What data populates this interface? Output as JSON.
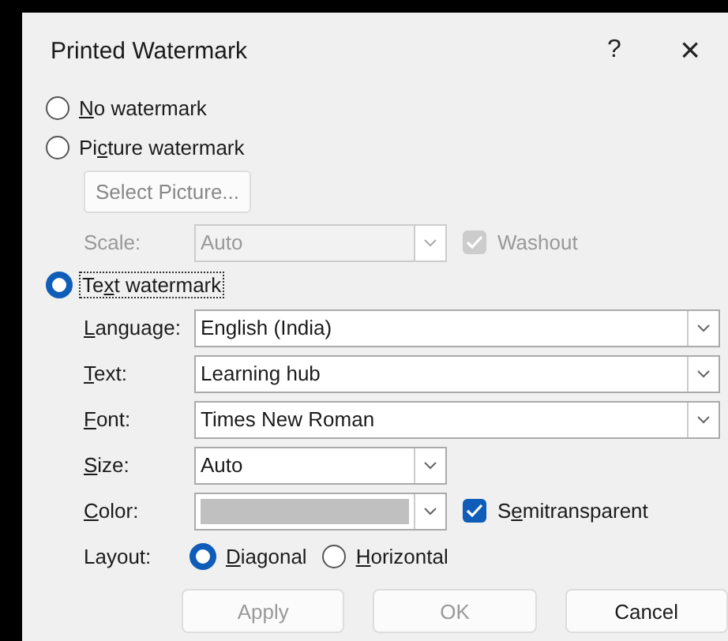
{
  "window": {
    "title": "Printed Watermark",
    "help": "?",
    "close": "×"
  },
  "options": [
    {
      "key": "N",
      "post": "o watermark",
      "selected": false
    },
    {
      "pre": "Pi",
      "key": "c",
      "post": "ture watermark",
      "selected": false
    },
    {
      "pre": "Te",
      "key": "x",
      "post": "t watermark",
      "selected": true,
      "focused": true
    }
  ],
  "picture": {
    "disabled": true,
    "select_button": "Select Picture...",
    "scale_label": "Scale:",
    "scale_value": "Auto",
    "washout": {
      "label": "Washout",
      "checked": true
    }
  },
  "text_fields": [
    {
      "key": "L",
      "post": "anguage:",
      "value": "English (India)",
      "kind": "wide"
    },
    {
      "key": "T",
      "post": "ext:",
      "value": "Learning hub",
      "kind": "wide"
    },
    {
      "key": "F",
      "post": "ont:",
      "value": "Times New Roman",
      "kind": "wide"
    },
    {
      "key": "S",
      "post": "ize:",
      "value": "Auto",
      "kind": "narrow"
    },
    {
      "key": "C",
      "post": "olor:",
      "color": "#c0c0c0",
      "kind": "color"
    }
  ],
  "semitransparent": {
    "pre": "S",
    "key": "e",
    "post": "mitransparent",
    "checked": true
  },
  "layout": {
    "label": "Layout:",
    "options": [
      {
        "key": "D",
        "post": "iagonal",
        "selected": true
      },
      {
        "key": "H",
        "post": "orizontal",
        "selected": false
      }
    ]
  },
  "buttons": [
    {
      "label": "Apply",
      "disabled": true
    },
    {
      "label": "OK",
      "disabled": true
    },
    {
      "label": "Cancel",
      "disabled": false
    }
  ]
}
